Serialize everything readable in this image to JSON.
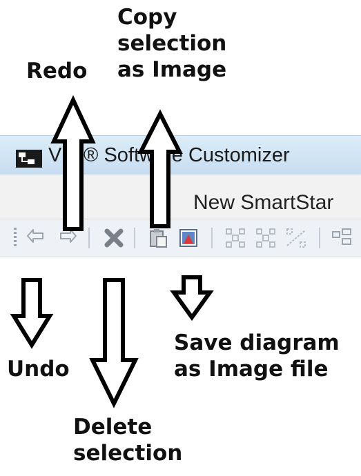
{
  "window": {
    "title": "VLT® Software Customizer",
    "icon": "app-diagram-icon"
  },
  "document_tab": {
    "label": "New SmartStar"
  },
  "toolbar": {
    "buttons": [
      {
        "name": "undo",
        "icon": "undo-arrow-icon"
      },
      {
        "name": "redo",
        "icon": "redo-arrow-icon"
      },
      {
        "name": "delete",
        "icon": "delete-x-icon"
      },
      {
        "name": "copy-image",
        "icon": "copy-clipboard-icon"
      },
      {
        "name": "save-image",
        "icon": "save-image-icon"
      },
      {
        "name": "layout-1",
        "icon": "grid-layout-icon"
      },
      {
        "name": "layout-2",
        "icon": "grid-layout-icon"
      },
      {
        "name": "layout-3",
        "icon": "grid-layout-icon"
      },
      {
        "name": "arrange",
        "icon": "arrange-icon"
      }
    ]
  },
  "callouts": {
    "redo": "Redo",
    "copy_line1": "Copy",
    "copy_line2": "selection",
    "copy_line3": "as Image",
    "undo": "Undo",
    "save_line1": "Save diagram",
    "save_line2": "as Image file",
    "delete_line1": "Delete",
    "delete_line2": "selection"
  },
  "colors": {
    "arrow_stroke": "#000000",
    "titlebar": "#cfe2f3",
    "toolbar": "#eef1f5"
  }
}
